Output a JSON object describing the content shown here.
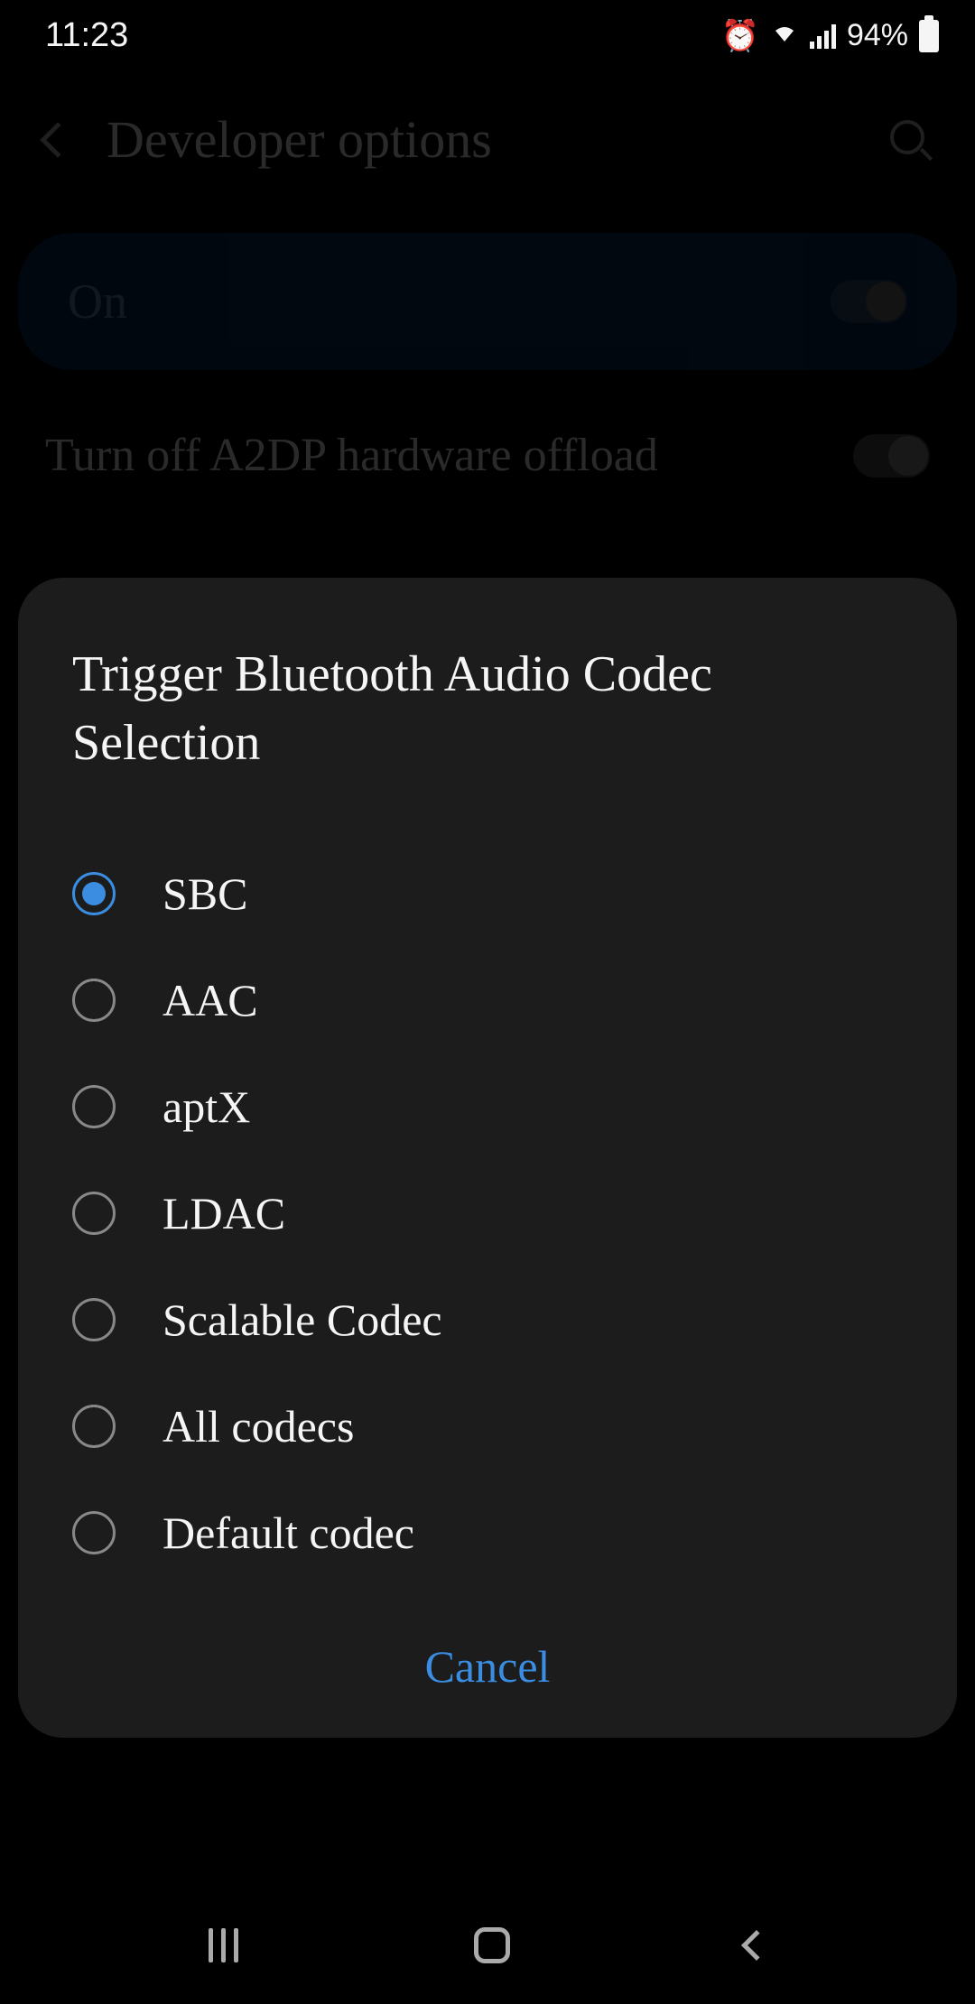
{
  "status": {
    "time": "11:23",
    "battery_pct": "94%"
  },
  "header": {
    "title": "Developer options"
  },
  "main_toggle": {
    "label": "On"
  },
  "setting": {
    "a2dp_label": "Turn off A2DP hardware offload"
  },
  "dialog": {
    "title": "Trigger Bluetooth Audio Codec Selection",
    "options": [
      {
        "label": "SBC",
        "selected": true
      },
      {
        "label": "AAC",
        "selected": false
      },
      {
        "label": "aptX",
        "selected": false
      },
      {
        "label": "LDAC",
        "selected": false
      },
      {
        "label": "Scalable Codec",
        "selected": false
      },
      {
        "label": "All codecs",
        "selected": false
      },
      {
        "label": "Default codec",
        "selected": false
      }
    ],
    "cancel": "Cancel"
  }
}
